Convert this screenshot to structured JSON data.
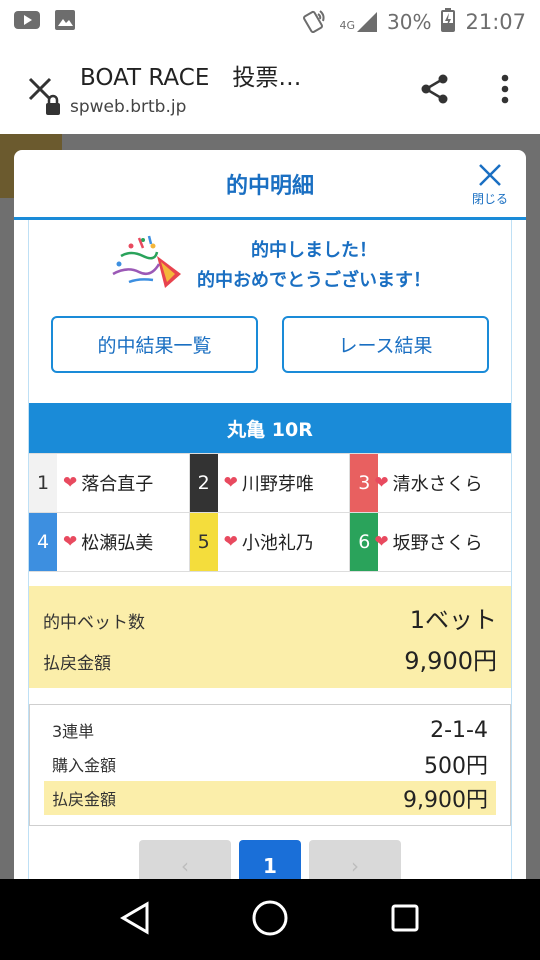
{
  "status_bar": {
    "network": "4G",
    "battery": "30%",
    "time": "21:07"
  },
  "browser": {
    "title": "BOAT RACE　投票…",
    "url": "spweb.brtb.jp"
  },
  "modal": {
    "title": "的中明細",
    "close_label": "閉じる",
    "congrats_line1": "的中しました！",
    "congrats_line2": "的中おめでとうございます！",
    "buttons": {
      "results_list": "的中結果一覧",
      "race_results": "レース結果"
    },
    "race": {
      "title": "丸亀 10R",
      "racers": [
        {
          "lane": "1",
          "name": "落合直子"
        },
        {
          "lane": "2",
          "name": "川野芽唯"
        },
        {
          "lane": "3",
          "name": "清水さくら"
        },
        {
          "lane": "4",
          "name": "松瀬弘美"
        },
        {
          "lane": "5",
          "name": "小池礼乃"
        },
        {
          "lane": "6",
          "name": "坂野さくら"
        }
      ]
    },
    "summary": {
      "hit_bets_label": "的中ベット数",
      "hit_bets_value": "1ベット",
      "payout_label": "払戻金額",
      "payout_value": "9,900円"
    },
    "detail": {
      "bet_type_label": "3連単",
      "bet_type_value": "2-1-4",
      "purchase_label": "購入金額",
      "purchase_value": "500円",
      "payout_label": "払戻金額",
      "payout_value": "9,900円"
    },
    "pager": {
      "prev": "‹",
      "current": "1",
      "next": "›"
    }
  },
  "colors": {
    "accent": "#1a8bd8",
    "highlight": "#fbeeaa",
    "lane_1": "#f2f2f2",
    "lane_2": "#333333",
    "lane_3": "#e86060",
    "lane_4": "#3d8fe0",
    "lane_5": "#f4dd3c",
    "lane_6": "#2aa35b"
  }
}
